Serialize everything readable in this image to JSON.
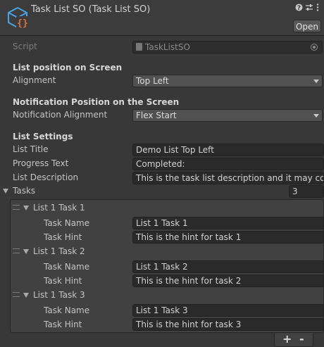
{
  "header": {
    "title": "Task List SO (Task List SO)",
    "open_label": "Open",
    "icons": [
      "script-asset-icon",
      "help-icon",
      "settings-sliders-icon",
      "more-menu-icon"
    ]
  },
  "script": {
    "label": "Script",
    "value": "TaskListSO"
  },
  "list_position": {
    "heading": "List position on Screen",
    "alignment_label": "Alignment",
    "alignment_value": "Top Left"
  },
  "notification_position": {
    "heading": "Notification Position on the Screen",
    "alignment_label": "Notification Alignment",
    "alignment_value": "Flex Start"
  },
  "list_settings": {
    "heading": "List Settings",
    "title_label": "List Title",
    "title_value": "Demo List Top Left",
    "progress_label": "Progress Text",
    "progress_value": "Completed:",
    "description_label": "List Description",
    "description_value": "This is the task list description and it may contain more text"
  },
  "tasks": {
    "label": "Tasks",
    "count": "3",
    "name_label": "Task Name",
    "hint_label": "Task Hint",
    "items": [
      {
        "header": "List 1 Task 1",
        "name": "List 1 Task 1",
        "hint": "This is the hint for task 1"
      },
      {
        "header": "List 1 Task 2",
        "name": "List 1 Task 2",
        "hint": "This is the hint for task 2"
      },
      {
        "header": "List 1 Task 3",
        "name": "List 1 Task 3",
        "hint": "This is the hint for task 3"
      }
    ],
    "add_label": "+",
    "remove_label": "-"
  },
  "colors": {
    "background": "#383838",
    "field": "#2a2a2a",
    "dropdown": "#515151",
    "list_box": "#414141",
    "icon_blue": "#4aa3e0",
    "icon_orange": "#e0723a"
  }
}
